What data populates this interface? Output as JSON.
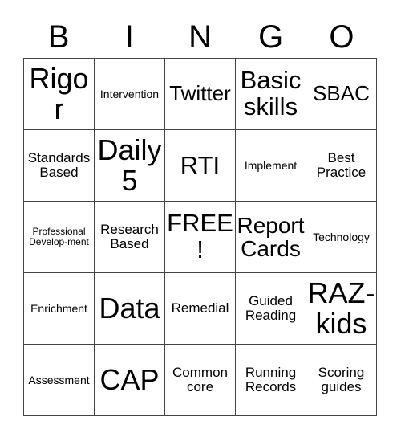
{
  "card": {
    "title": "Bingo Card",
    "headers": [
      "B",
      "I",
      "N",
      "G",
      "O"
    ],
    "grid_line_color": "#444444",
    "background_color": "#ffffff",
    "text_color": "#000000",
    "rows": [
      [
        {
          "text": "Rigor",
          "size": "huge"
        },
        {
          "text": "Intervention",
          "size": "s"
        },
        {
          "text": "Twitter",
          "size": "xl"
        },
        {
          "text": "Basic skills",
          "size": "xxl"
        },
        {
          "text": "SBAC",
          "size": "xl"
        }
      ],
      [
        {
          "text": "Standards Based",
          "size": "m"
        },
        {
          "text": "Daily 5",
          "size": "huge"
        },
        {
          "text": "RTI",
          "size": "xxl"
        },
        {
          "text": "Implement",
          "size": "s"
        },
        {
          "text": "Best Practice",
          "size": "m"
        }
      ],
      [
        {
          "text": "Professional Develop-ment",
          "size": "xs"
        },
        {
          "text": "Research Based",
          "size": "m"
        },
        {
          "text": "FREE!",
          "size": "xxl"
        },
        {
          "text": "Report Cards",
          "size": "xxl"
        },
        {
          "text": "Technology",
          "size": "s"
        }
      ],
      [
        {
          "text": "Enrichment",
          "size": "s"
        },
        {
          "text": "Data",
          "size": "huge"
        },
        {
          "text": "Remedial",
          "size": "m"
        },
        {
          "text": "Guided Reading",
          "size": "m"
        },
        {
          "text": "RAZ-kids",
          "size": "huge"
        }
      ],
      [
        {
          "text": "Assessment",
          "size": "s"
        },
        {
          "text": "CAP",
          "size": "huge"
        },
        {
          "text": "Common core",
          "size": "m"
        },
        {
          "text": "Running Records",
          "size": "m"
        },
        {
          "text": "Scoring guides",
          "size": "m"
        }
      ]
    ]
  }
}
